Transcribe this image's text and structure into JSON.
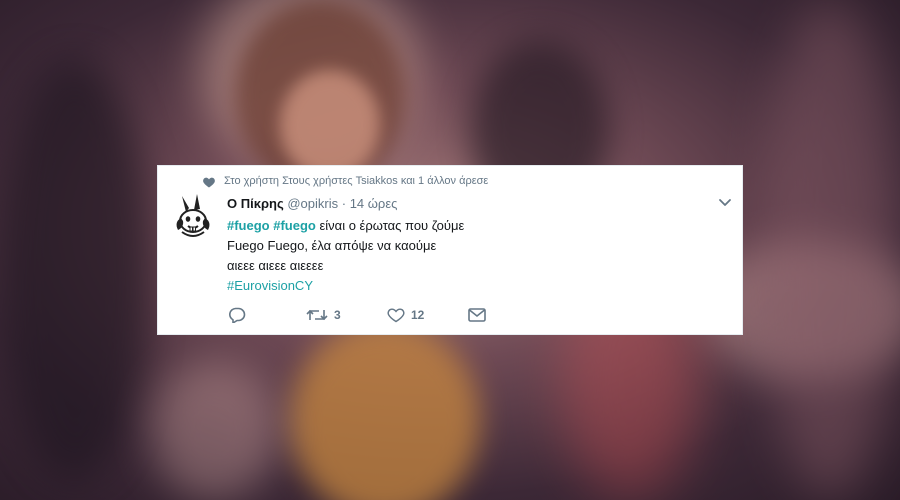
{
  "tweet": {
    "social_context": "Στο χρήστη Στους χρήστες Tsiakkos και 1 άλλον άρεσε",
    "author_name": "Ο Πίκρης",
    "handle": "@opikris",
    "separator": "·",
    "time": "14 ώρες",
    "lines": {
      "line1_tag1": "#fuego",
      "line1_tag2": "#fuego",
      "line1_rest": "είναι ο έρωτας που ζούμε",
      "line2": "Fuego Fuego, έλα απόψε να καούμε",
      "line3": "αιεεε αιεεε αιεεεε",
      "line4_tag": "#EurovisionCY"
    },
    "retweet_count": "3",
    "like_count": "12"
  },
  "icons": {
    "social_heart": "heart-icon",
    "avatar": "rabbit-avatar-icon",
    "caret": "chevron-down-icon",
    "reply": "reply-icon",
    "retweet": "retweet-icon",
    "like": "like-heart-icon",
    "message": "envelope-icon"
  },
  "colors": {
    "hashtag": "#1da1a5",
    "muted": "#657786",
    "text": "#14171a",
    "card": "#ffffff"
  }
}
